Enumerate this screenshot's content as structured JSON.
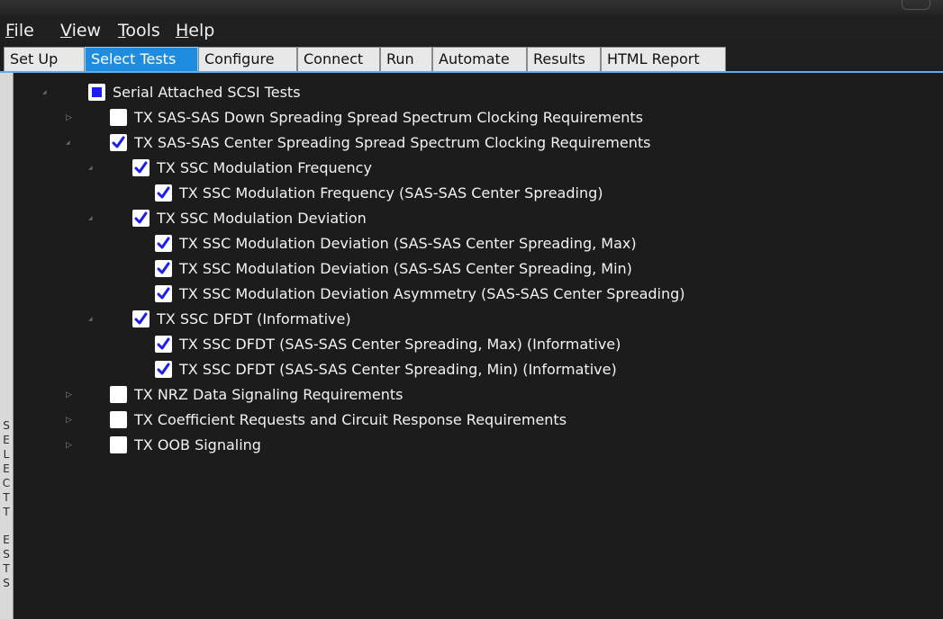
{
  "menu": [
    {
      "accel": "F",
      "rest": "ile"
    },
    {
      "accel": "V",
      "rest": "iew"
    },
    {
      "accel": "T",
      "rest": "ools"
    },
    {
      "accel": "H",
      "rest": "elp"
    }
  ],
  "tabs": [
    "Set Up",
    "Select Tests",
    "Configure",
    "Connect",
    "Run",
    "Automate",
    "Results",
    "HTML Report"
  ],
  "active_tab": "Select Tests",
  "sidebar_label": "SELECT TESTS",
  "tree": [
    {
      "label": "Serial Attached SCSI Tests",
      "state": "partial",
      "expander": "expanded"
    },
    {
      "label": "TX SAS-SAS Down Spreading Spread Spectrum Clocking Requirements",
      "state": "unchecked",
      "expander": "collapsed"
    },
    {
      "label": "TX SAS-SAS Center Spreading Spread Spectrum Clocking Requirements",
      "state": "checked",
      "expander": "expanded"
    },
    {
      "label": "TX SSC Modulation Frequency",
      "state": "checked",
      "expander": "expanded"
    },
    {
      "label": "TX SSC Modulation Frequency (SAS-SAS Center Spreading)",
      "state": "checked",
      "expander": "none"
    },
    {
      "label": "TX SSC Modulation Deviation",
      "state": "checked",
      "expander": "expanded"
    },
    {
      "label": "TX SSC Modulation Deviation (SAS-SAS Center Spreading, Max)",
      "state": "checked",
      "expander": "none"
    },
    {
      "label": "TX SSC Modulation Deviation (SAS-SAS Center Spreading, Min)",
      "state": "checked",
      "expander": "none"
    },
    {
      "label": "TX SSC Modulation Deviation Asymmetry (SAS-SAS Center Spreading)",
      "state": "checked",
      "expander": "none"
    },
    {
      "label": "TX SSC DFDT (Informative)",
      "state": "checked",
      "expander": "expanded"
    },
    {
      "label": "TX SSC DFDT (SAS-SAS Center Spreading, Max) (Informative)",
      "state": "checked",
      "expander": "none"
    },
    {
      "label": "TX SSC DFDT (SAS-SAS Center Spreading, Min) (Informative)",
      "state": "checked",
      "expander": "none"
    },
    {
      "label": "TX NRZ Data Signaling Requirements",
      "state": "unchecked",
      "expander": "collapsed"
    },
    {
      "label": "TX Coefficient Requests and Circuit Response Requirements",
      "state": "unchecked",
      "expander": "collapsed"
    },
    {
      "label": "TX OOB Signaling",
      "state": "unchecked",
      "expander": "collapsed"
    }
  ],
  "colors": {
    "background": "#1c1c1c",
    "active_tab": "#1f8ce0",
    "checkmark": "#1a1ef0",
    "text": "#f2f2f2"
  }
}
